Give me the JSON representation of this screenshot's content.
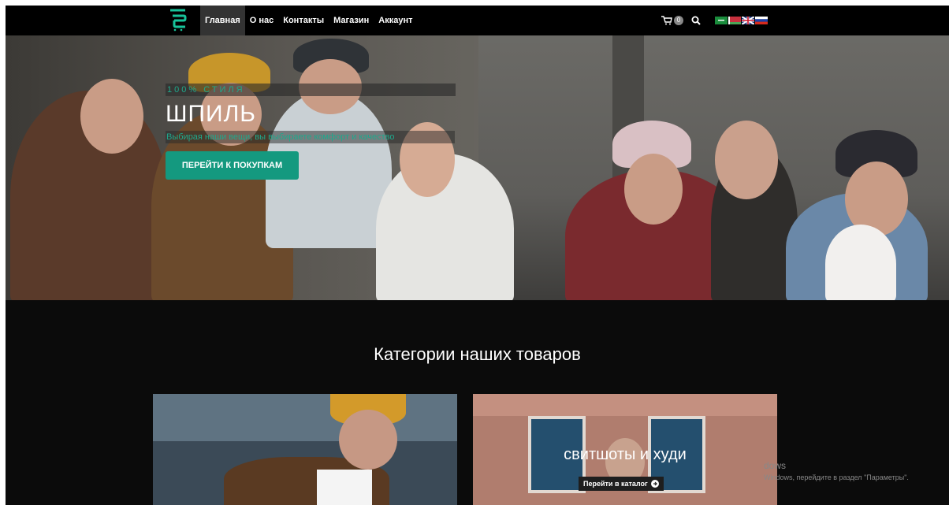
{
  "nav": {
    "items": [
      {
        "label": "Главная",
        "active": true
      },
      {
        "label": "О нас"
      },
      {
        "label": "Контакты"
      },
      {
        "label": "Магазин"
      },
      {
        "label": "Аккаунт"
      }
    ],
    "cart_count": "0",
    "icons": [
      "logo-icon",
      "cart-icon",
      "search-icon"
    ],
    "flags": [
      "flag-sa",
      "flag-by",
      "flag-uk",
      "flag-ru"
    ]
  },
  "hero": {
    "eyebrow": "100% СТИЛЯ",
    "title": "ШПИЛЬ",
    "subtitle": "Выбирая наши вещи, вы выбираете комфорт и качество",
    "button": "ПЕРЕЙТИ К ПОКУПКАМ"
  },
  "categories": {
    "title": "Категории наших товаров",
    "cards": [
      {
        "label": "",
        "link": ""
      },
      {
        "label": "свитшоты и худи",
        "link": "Перейти в каталог"
      }
    ]
  },
  "watermark": {
    "line1": "dows",
    "line2": "Windows, перейдите в раздел \"Параметры\"."
  },
  "colors": {
    "accent": "#14997f",
    "accent_text": "#1fa88c",
    "background": "#0b0b0b"
  }
}
